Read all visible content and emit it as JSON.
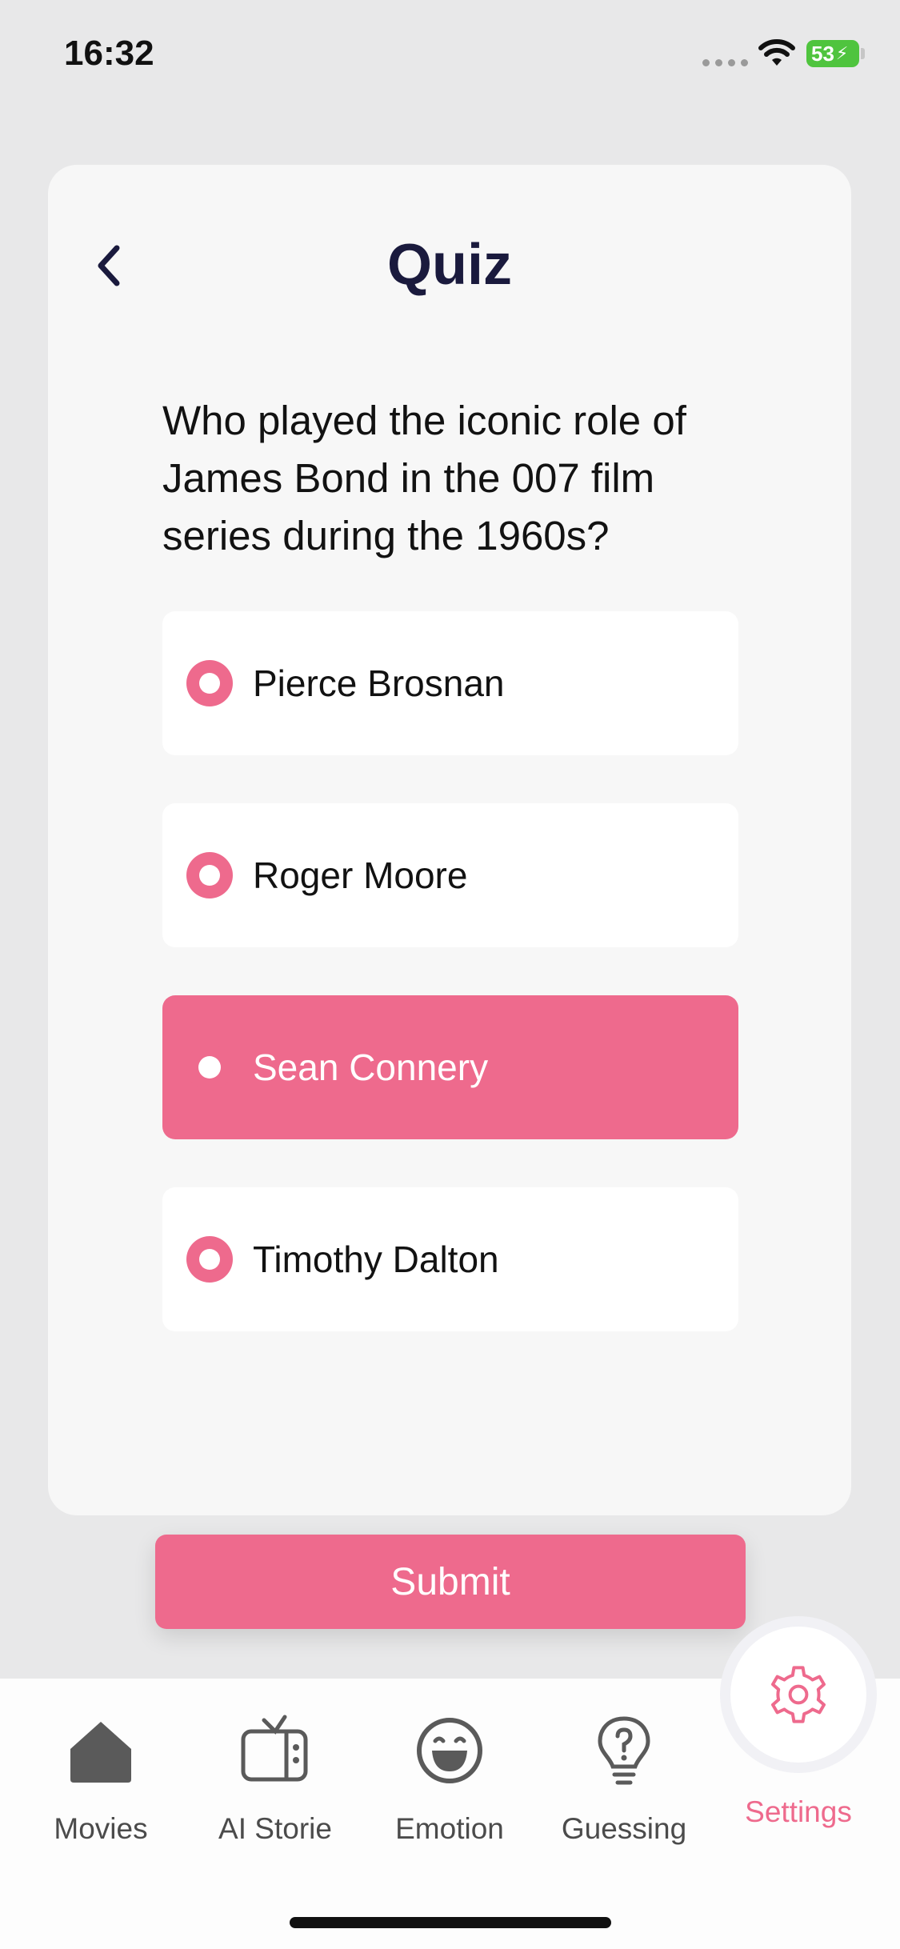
{
  "status_bar": {
    "time": "16:32",
    "battery": "53"
  },
  "header": {
    "title": "Quiz"
  },
  "question": "Who played the iconic role of James Bond in the 007 film series during the 1960s?",
  "options": [
    {
      "label": "Pierce Brosnan",
      "selected": false
    },
    {
      "label": "Roger Moore",
      "selected": false
    },
    {
      "label": "Sean Connery",
      "selected": true
    },
    {
      "label": "Timothy Dalton",
      "selected": false
    }
  ],
  "submit_label": "Submit",
  "tabs": [
    {
      "label": "Movies",
      "icon": "home-icon"
    },
    {
      "label": "AI Storie",
      "icon": "tv-icon"
    },
    {
      "label": "Emotion",
      "icon": "laugh-emoji-icon"
    },
    {
      "label": "Guessing",
      "icon": "lightbulb-question-icon"
    },
    {
      "label": "Settings",
      "icon": "gear-icon",
      "active": true
    }
  ],
  "colors": {
    "accent": "#ee6a8d",
    "title": "#1a1a3d",
    "background": "#e8e8e9",
    "card": "#f7f7f7"
  }
}
